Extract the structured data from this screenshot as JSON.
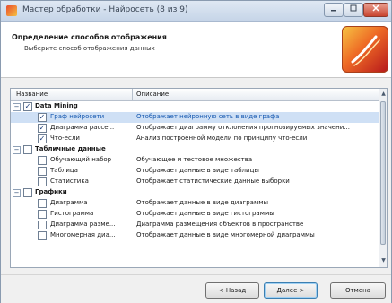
{
  "window": {
    "title": "Мастер обработки - Найросеть (8 из 9)"
  },
  "header": {
    "title": "Определение способов отображения",
    "subtitle": "Выберите способ отображения данных"
  },
  "table": {
    "columns": [
      "Название",
      "Описание"
    ],
    "groups": [
      {
        "name": "Data Mining",
        "checked": true,
        "items": [
          {
            "name": "Граф нейросети",
            "desc": "Отображает нейронную сеть в виде графа",
            "checked": true,
            "selected": true
          },
          {
            "name": "Диаграмма рассе...",
            "desc": "Отображает диаграмму отклонения прогнозируемых значени...",
            "checked": true
          },
          {
            "name": "Что-если",
            "desc": "Анализ построенной модели по принципу что-если",
            "checked": true
          }
        ]
      },
      {
        "name": "Табличные данные",
        "checked": false,
        "items": [
          {
            "name": "Обучающий набор",
            "desc": "Обучающее и тестовое множества",
            "checked": false
          },
          {
            "name": "Таблица",
            "desc": "Отображает данные в виде таблицы",
            "checked": false
          },
          {
            "name": "Статистика",
            "desc": "Отображает статистические данные выборки",
            "checked": false
          }
        ]
      },
      {
        "name": "Графики",
        "checked": false,
        "items": [
          {
            "name": "Диаграмма",
            "desc": "Отображает данные в виде диаграммы",
            "checked": false
          },
          {
            "name": "Гистограмма",
            "desc": "Отображает данные в виде гистограммы",
            "checked": false
          },
          {
            "name": "Диаграмма разме...",
            "desc": "Диаграмма размещения объектов в пространстве",
            "checked": false
          },
          {
            "name": "Многомерная диа...",
            "desc": "Отображает данные в виде многомерной диаграммы",
            "checked": false
          }
        ]
      }
    ]
  },
  "buttons": {
    "back": "< Назад",
    "next": "Далее >",
    "cancel": "Отмена"
  },
  "icons": {
    "expand": "minus-icon",
    "check": "check-icon",
    "logo": "wizard-logo"
  },
  "colors": {
    "selection": "#cfe0f5",
    "selected_text": "#1558b0"
  }
}
